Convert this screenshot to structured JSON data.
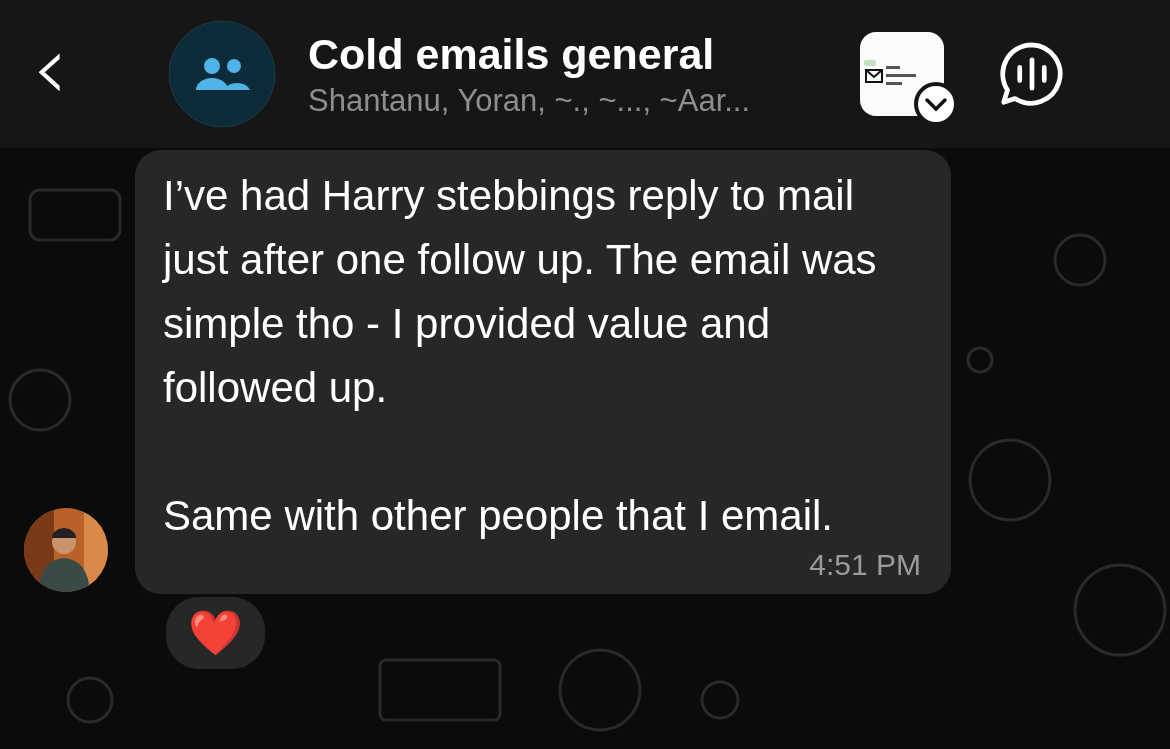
{
  "header": {
    "back_icon": "‹",
    "title": "Cold emails general",
    "subtitle": "Shantanu, Yoran, ~., ~..., ~Aar..."
  },
  "message": {
    "text": "I’ve had Harry stebbings reply to mail just after one follow up. The email was simple tho - I provided value and followed up.\n\nSame with other people that I email.",
    "time": "4:51 PM",
    "reaction": "❤️"
  }
}
